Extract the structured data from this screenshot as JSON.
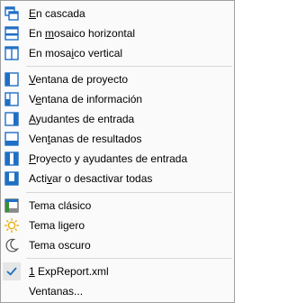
{
  "colors": {
    "accent": "#1f6fc4",
    "sun": "#e6a800",
    "green": "#3a8f3a"
  },
  "menu": {
    "items": [
      {
        "id": "cascade",
        "icon": "cascade-windows-icon",
        "mnemonic": "E",
        "rest": "n cascada"
      },
      {
        "id": "tile-h",
        "icon": "tile-horizontal-icon",
        "pre": "En ",
        "mnemonic": "m",
        "rest": "osaico horizontal"
      },
      {
        "id": "tile-v",
        "icon": "tile-vertical-icon",
        "pre": "En mosa",
        "mnemonic": "i",
        "rest": "co vertical"
      },
      {
        "id": "project",
        "icon": "project-window-icon",
        "mnemonic": "V",
        "rest": "entana de proyecto"
      },
      {
        "id": "info",
        "icon": "info-window-icon",
        "pre": "V",
        "mnemonic": "e",
        "rest": "ntana de información"
      },
      {
        "id": "entry-helpers",
        "icon": "entry-helpers-icon",
        "mnemonic": "A",
        "rest": "yudantes de entrada"
      },
      {
        "id": "results",
        "icon": "results-window-icon",
        "pre": "Ven",
        "mnemonic": "t",
        "rest": "anas de resultados"
      },
      {
        "id": "project-entry",
        "icon": "project-entry-icon",
        "mnemonic": "P",
        "rest": "royecto y ayudantes de entrada"
      },
      {
        "id": "toggle-all",
        "icon": "toggle-all-icon",
        "pre": "Acti",
        "mnemonic": "v",
        "rest": "ar o desactivar todas"
      },
      {
        "id": "theme-classic",
        "icon": "classic-theme-icon",
        "text": "Tema clásico"
      },
      {
        "id": "theme-light",
        "icon": "sun-icon",
        "text": "Tema ligero"
      },
      {
        "id": "theme-dark",
        "icon": "moon-icon",
        "text": "Tema oscuro"
      },
      {
        "id": "doc-1",
        "icon": "checkmark-icon",
        "mnemonic": "1",
        "rest": " ExpReport.xml",
        "checked": true
      },
      {
        "id": "windows",
        "icon": "",
        "text": "Ventanas..."
      }
    ]
  }
}
